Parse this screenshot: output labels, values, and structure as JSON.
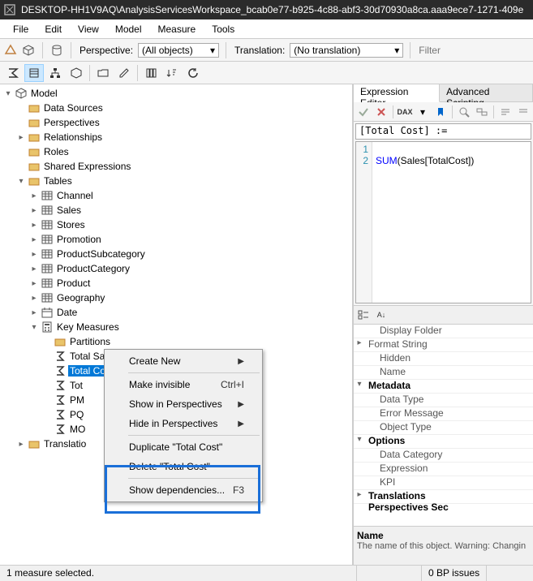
{
  "titlebar": {
    "text": "DESKTOP-HH1V9AQ\\AnalysisServicesWorkspace_bcab0e77-b925-4c88-abf3-30d70930a8ca.aaa9ece7-1271-409e"
  },
  "menu": {
    "file": "File",
    "edit": "Edit",
    "view": "View",
    "model": "Model",
    "measure": "Measure",
    "tools": "Tools"
  },
  "toolbar": {
    "perspective_label": "Perspective:",
    "perspective_value": "(All objects)",
    "translation_label": "Translation:",
    "translation_value": "(No translation)",
    "filter_placeholder": "Filter"
  },
  "tree": {
    "root": "Model",
    "folders": {
      "data_sources": "Data Sources",
      "perspectives": "Perspectives",
      "relationships": "Relationships",
      "roles": "Roles",
      "shared_expressions": "Shared Expressions",
      "tables": "Tables",
      "translations": "Translatio"
    },
    "tables": [
      "Channel",
      "Sales",
      "Stores",
      "Promotion",
      "ProductSubcategory",
      "ProductCategory",
      "Product",
      "Geography",
      "Date",
      "Key Measures"
    ],
    "key_measures": {
      "partitions": "Partitions",
      "measures": [
        "Total Sales",
        "Total Cost",
        "Tot",
        "PM",
        "PQ",
        "MO"
      ]
    }
  },
  "context": {
    "create_new": "Create New",
    "make_invisible": "Make invisible",
    "make_invisible_shortcut": "Ctrl+I",
    "show_in": "Show in Perspectives",
    "hide_in": "Hide in Perspectives",
    "duplicate": "Duplicate \"Total Cost\"",
    "delete": "Delete \"Total Cost\"",
    "show_deps": "Show dependencies...",
    "show_deps_shortcut": "F3"
  },
  "editor": {
    "tab1": "Expression Editor",
    "tab2": "Advanced Scripting",
    "formula": "[Total Cost] :=",
    "line1": "1",
    "line2": "2",
    "code_fn": "SUM",
    "code_rest": "(Sales[TotalCost])"
  },
  "props": {
    "display_folder": "Display Folder",
    "format_string": "Format String",
    "hidden": "Hidden",
    "name": "Name",
    "metadata": "Metadata",
    "data_type": "Data Type",
    "error_message": "Error Message",
    "object_type": "Object Type",
    "options": "Options",
    "data_category": "Data Category",
    "expression": "Expression",
    "kpi": "KPI",
    "translations": "Translations  Perspectives  Sec",
    "desc_title": "Name",
    "desc_text": "The name of this object. Warning: Changin"
  },
  "status": {
    "left": "1 measure selected.",
    "right": "0 BP issues"
  }
}
